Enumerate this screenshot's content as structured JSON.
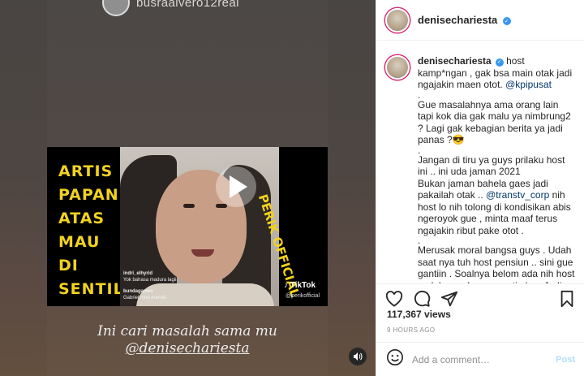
{
  "media": {
    "story_handle": "busraalvero12real",
    "video_text_left": [
      "ARTIS",
      "PAPAN",
      "ATAS",
      "MAU",
      "DI",
      "SENTIL"
    ],
    "watermark_vertical": "PERIK OFFICIAL",
    "tiktok_logo": "TikTok",
    "tiktok_handle": "@perikofficial",
    "comment1_user": "indri_elhyrid",
    "comment1_text": "Yok bahasa madura lagii",
    "comment2_user": "bundagamex",
    "comment2_text": "Gabriel mna mamiiii",
    "caption_line1": "Ini cari masalah sama mu",
    "caption_line2": "@denisechariesta",
    "sound_icon": "speaker-icon"
  },
  "side": {
    "username": "denisechariesta",
    "verified_icon": "verified-badge-icon",
    "caption": {
      "user": "denisechariesta",
      "line_a": "host kamp*ngan , gak bsa main otak jadi ngajakin maen otot.",
      "mention_a": "@kpipusat",
      "para2": "Gue masalahnya ama orang lain tapi kok dia gak malu ya nimbrung2 ? Lagi gak kebagian berita ya jadi panas ?😎",
      "para3_a": "Jangan di tiru ya guys prilaku host ini .. ini uda jaman 2021",
      "para3_b": "Bukan jaman bahela gaes jadi pakailah otak ..",
      "mention_b": "@transtv_corp",
      "para3_c": "nih host lo nih tolong di kondisikan abis ngeroyok gue , minta maaf terus ngajakin ribut pake otot .",
      "para4": "Merusak moral bangsa guys . Udah saat nya tuh host pensiun .. sini gue gantiin . Soalnya belom ada nih host cadel yang lucu seperti aku . Jadi pasti"
    },
    "views": "117,367 views",
    "time": "9 HOURS AGO",
    "comment_placeholder": "Add a comment…",
    "post_label": "Post"
  }
}
